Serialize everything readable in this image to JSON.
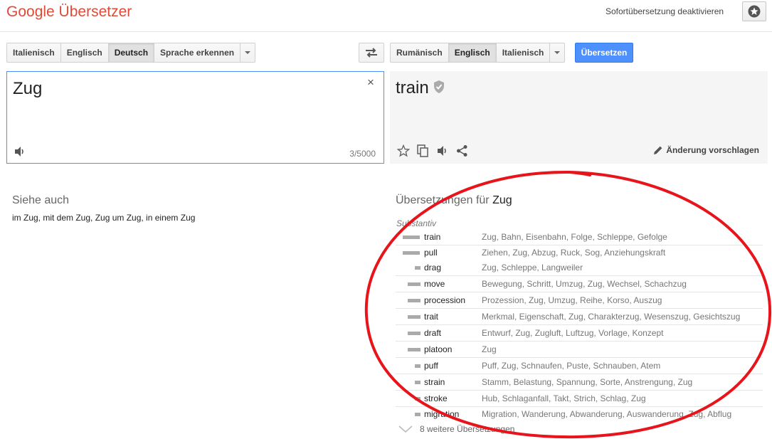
{
  "header": {
    "logo": "Google Übersetzer",
    "instant_toggle": "Sofortübersetzung deaktivieren"
  },
  "source_langs": [
    "Italienisch",
    "Englisch",
    "Deutsch",
    "Sprache erkennen"
  ],
  "target_langs": [
    "Rumänisch",
    "Englisch",
    "Italienisch"
  ],
  "translate_button": "Übersetzen",
  "source": {
    "text": "Zug",
    "clear": "×",
    "char_count": "3/5000"
  },
  "result": {
    "text": "train",
    "suggest_edit": "Änderung vorschlagen"
  },
  "see_also": {
    "title": "Siehe auch",
    "body": "im Zug, mit dem Zug, Zug um Zug, in einem Zug"
  },
  "dictionary": {
    "title_prefix": "Übersetzungen für",
    "title_word": "Zug",
    "pos": "Substantiv",
    "entries": [
      {
        "word": "train",
        "translations": "Zug, Bahn, Eisenbahn, Folge, Schleppe, Gefolge",
        "frequency": 4
      },
      {
        "word": "pull",
        "translations": "Ziehen, Zug, Abzug, Ruck, Sog, Anziehungskraft",
        "frequency": 4
      },
      {
        "word": "drag",
        "translations": "Zug, Schleppe, Langweiler",
        "frequency": 2
      },
      {
        "word": "move",
        "translations": "Bewegung, Schritt, Umzug, Zug, Wechsel, Schachzug",
        "frequency": 3
      },
      {
        "word": "procession",
        "translations": "Prozession, Zug, Umzug, Reihe, Korso, Auszug",
        "frequency": 3
      },
      {
        "word": "trait",
        "translations": "Merkmal, Eigenschaft, Zug, Charakterzug, Wesenszug, Gesichtszug",
        "frequency": 3
      },
      {
        "word": "draft",
        "translations": "Entwurf, Zug, Zugluft, Luftzug, Vorlage, Konzept",
        "frequency": 3
      },
      {
        "word": "platoon",
        "translations": "Zug",
        "frequency": 3
      },
      {
        "word": "puff",
        "translations": "Puff, Zug, Schnaufen, Puste, Schnauben, Atem",
        "frequency": 2
      },
      {
        "word": "strain",
        "translations": "Stamm, Belastung, Spannung, Sorte, Anstrengung, Zug",
        "frequency": 2
      },
      {
        "word": "stroke",
        "translations": "Hub, Schlaganfall, Takt, Strich, Schlag, Zug",
        "frequency": 2
      },
      {
        "word": "migration",
        "translations": "Migration, Wanderung, Abwanderung, Auswanderung, Zug, Abflug",
        "frequency": 2
      }
    ],
    "more_link": "8 weitere Übersetzungen"
  },
  "colors": {
    "accent_red": "#dd4b39",
    "button_blue": "#4d90fe",
    "annotation_red": "#e8141b"
  },
  "icons": [
    "star-icon",
    "swap-icon",
    "close-icon",
    "speaker-icon",
    "shield-icon",
    "copy-icon",
    "share-icon",
    "pencil-icon",
    "chevron-down-icon"
  ]
}
